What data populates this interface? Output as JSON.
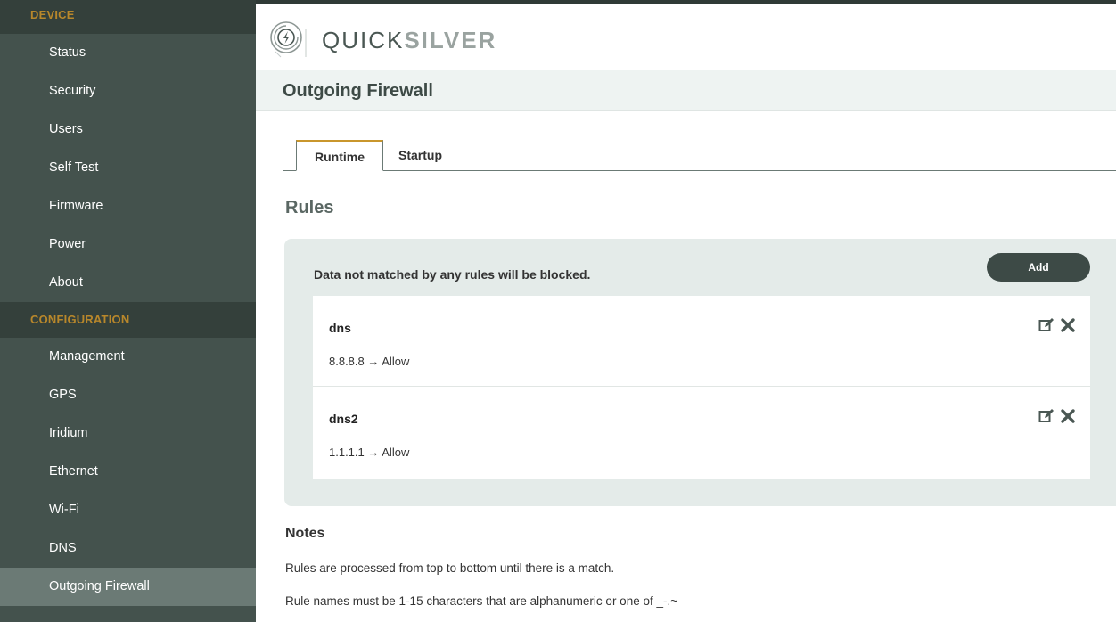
{
  "brand": {
    "name_light": "QUICK",
    "name_bold": "SILVER"
  },
  "sidebar": {
    "device_header": "DEVICE",
    "device_items": [
      {
        "label": "Status"
      },
      {
        "label": "Security"
      },
      {
        "label": "Users"
      },
      {
        "label": "Self Test"
      },
      {
        "label": "Firmware"
      },
      {
        "label": "Power"
      },
      {
        "label": "About"
      }
    ],
    "config_header": "CONFIGURATION",
    "config_items": [
      {
        "label": "Management"
      },
      {
        "label": "GPS"
      },
      {
        "label": "Iridium"
      },
      {
        "label": "Ethernet"
      },
      {
        "label": "Wi-Fi"
      },
      {
        "label": "DNS"
      },
      {
        "label": "Outgoing Firewall",
        "active": true
      }
    ]
  },
  "page": {
    "title": "Outgoing Firewall"
  },
  "tabs": [
    {
      "label": "Runtime",
      "active": true
    },
    {
      "label": "Startup"
    }
  ],
  "rules": {
    "section_title": "Rules",
    "message": "Data not matched by any rules will be blocked.",
    "add_label": "Add",
    "items": [
      {
        "name": "dns",
        "detail": "8.8.8.8 → Allow",
        "icons": [
          "edit-icon",
          "delete-icon"
        ]
      },
      {
        "name": "dns2",
        "detail": "1.1.1.1 → Allow",
        "icons": [
          "edit-icon",
          "delete-icon"
        ]
      }
    ]
  },
  "notes": {
    "title": "Notes",
    "lines": [
      "Rules are processed from top to bottom until there is a match.",
      "Rule names must be 1-15 characters that are alphanumeric or one of _-.~"
    ]
  },
  "colors": {
    "sidebar_bg": "#44524d",
    "sidebar_header_bg": "#34403b",
    "sidebar_header_text": "#b8872b",
    "sidebar_active": "#6b7a75",
    "accent": "#c9962c",
    "button_bg": "#3d4a46",
    "panel_bg": "#e4ebe9"
  }
}
